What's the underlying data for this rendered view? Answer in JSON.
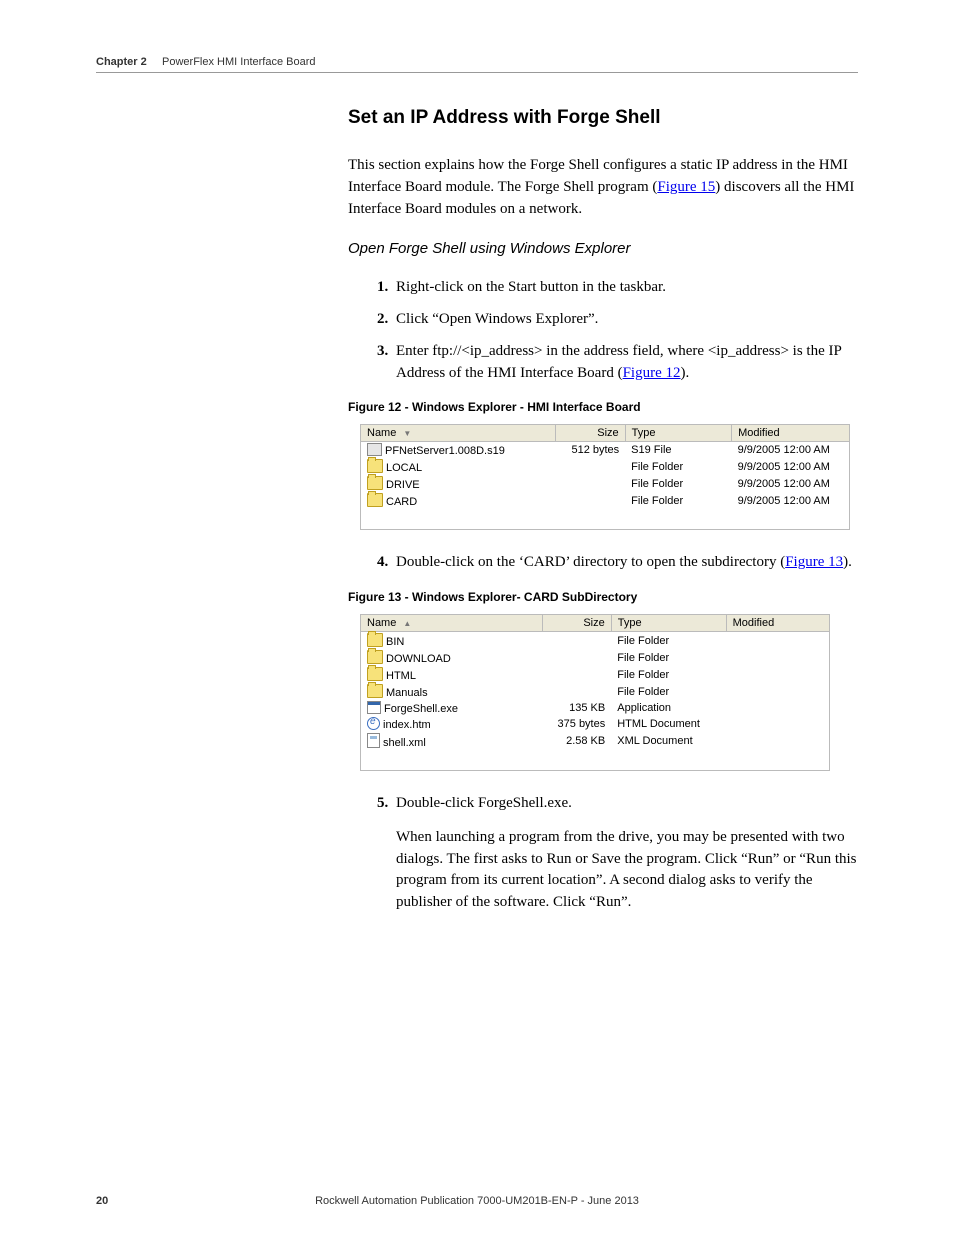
{
  "header": {
    "chapter": "Chapter 2",
    "title": "PowerFlex HMI Interface Board"
  },
  "section_heading": "Set an IP Address with Forge Shell",
  "intro_pre": "This section explains how the Forge Shell configures a static IP address in the HMI Interface Board module. The Forge Shell program (",
  "intro_link": "Figure 15",
  "intro_post": ") discovers all the HMI Interface Board modules on a network.",
  "subheading": "Open Forge Shell using Windows Explorer",
  "steps123": {
    "s1": "Right-click on the Start button in the taskbar.",
    "s2": "Click “Open Windows Explorer”.",
    "s3_pre": "Enter ftp://<ip_address> in the address field, where <ip_address> is the IP Address of the HMI Interface Board (",
    "s3_link": "Figure 12",
    "s3_post": ")."
  },
  "fig12": {
    "caption": "Figure 12 - Windows Explorer - HMI Interface Board",
    "columns": {
      "name": "Name",
      "size": "Size",
      "type": "Type",
      "modified": "Modified"
    },
    "rows": [
      {
        "icon": "s19",
        "name": "PFNetServer1.008D.s19",
        "size": "512 bytes",
        "type": "S19 File",
        "modified": "9/9/2005 12:00 AM"
      },
      {
        "icon": "folder",
        "name": "LOCAL",
        "size": "",
        "type": "File Folder",
        "modified": "9/9/2005 12:00 AM"
      },
      {
        "icon": "folder",
        "name": "DRIVE",
        "size": "",
        "type": "File Folder",
        "modified": "9/9/2005 12:00 AM"
      },
      {
        "icon": "folder",
        "name": "CARD",
        "size": "",
        "type": "File Folder",
        "modified": "9/9/2005 12:00 AM"
      }
    ],
    "sort_dir": "desc"
  },
  "step4_pre": "Double-click on the ‘CARD’ directory to open the subdirectory (",
  "step4_link": "Figure 13",
  "step4_post": ").",
  "fig13": {
    "caption": "Figure 13 - Windows Explorer- CARD SubDirectory",
    "columns": {
      "name": "Name",
      "size": "Size",
      "type": "Type",
      "modified": "Modified"
    },
    "rows": [
      {
        "icon": "folder",
        "name": "BIN",
        "size": "",
        "type": "File Folder",
        "modified": ""
      },
      {
        "icon": "folder",
        "name": "DOWNLOAD",
        "size": "",
        "type": "File Folder",
        "modified": ""
      },
      {
        "icon": "folder",
        "name": "HTML",
        "size": "",
        "type": "File Folder",
        "modified": ""
      },
      {
        "icon": "folder",
        "name": "Manuals",
        "size": "",
        "type": "File Folder",
        "modified": ""
      },
      {
        "icon": "app",
        "name": "ForgeShell.exe",
        "size": "135 KB",
        "type": "Application",
        "modified": ""
      },
      {
        "icon": "ie",
        "name": "index.htm",
        "size": "375 bytes",
        "type": "HTML Document",
        "modified": ""
      },
      {
        "icon": "xml",
        "name": "shell.xml",
        "size": "2.58 KB",
        "type": "XML Document",
        "modified": ""
      }
    ],
    "sort_dir": "asc"
  },
  "step5": "Double-click ForgeShell.exe.",
  "step5_para": "When launching a program from the drive, you may be presented with two dialogs. The first asks to Run or Save the program. Click “Run” or “Run this program from its current location”. A second dialog asks to verify the publisher of the software. Click “Run”.",
  "footer": {
    "page": "20",
    "pub": "Rockwell Automation Publication 7000-UM201B-EN-P - June 2013"
  }
}
